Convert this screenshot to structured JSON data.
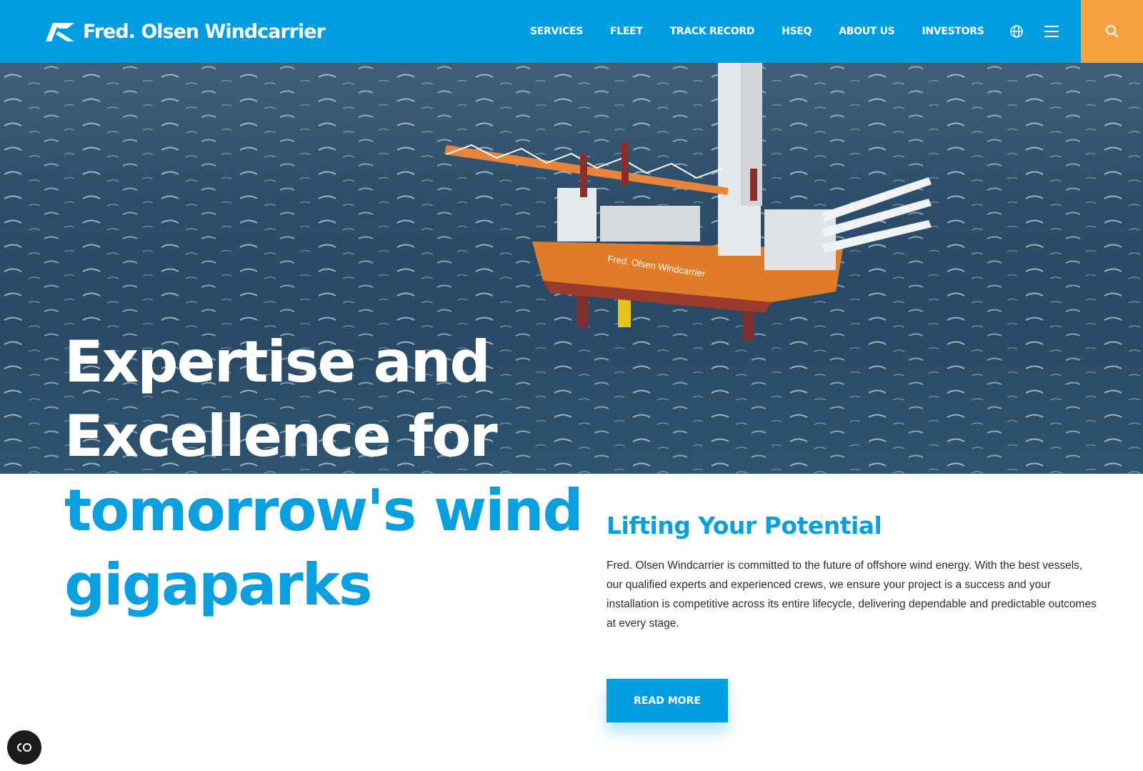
{
  "brand": {
    "name": "Fred. Olsen Windcarrier"
  },
  "nav": {
    "items": [
      "SERVICES",
      "FLEET",
      "TRACK RECORD",
      "HSEQ",
      "ABOUT US",
      "INVESTORS"
    ]
  },
  "icons": {
    "language": "globe-icon",
    "menu": "hamburger-menu-icon",
    "search": "search-icon",
    "accessibility": "accessibility-icon"
  },
  "hero": {
    "headline_line1": "Expertise and",
    "headline_line2": "Excellence for",
    "headline_line3": "tomorrow's wind",
    "headline_line4": "gigaparks",
    "image_text": "Fred. Olsen Windcarrier"
  },
  "content": {
    "subheading": "Lifting Your Potential",
    "body": "Fred. Olsen Windcarrier is committed to the future of offshore wind energy. With the best vessels, our qualified experts and experienced crews, we ensure your project is a success and your installation is competitive across its entire lifecycle, delivering dependable and predictable outcomes at every stage.",
    "cta_label": "READ MORE"
  },
  "colors": {
    "primary_blue": "#009ee0",
    "accent_orange": "#f5a13d",
    "headline_blue": "#0aa0e0",
    "text": "#2b2b2b"
  }
}
